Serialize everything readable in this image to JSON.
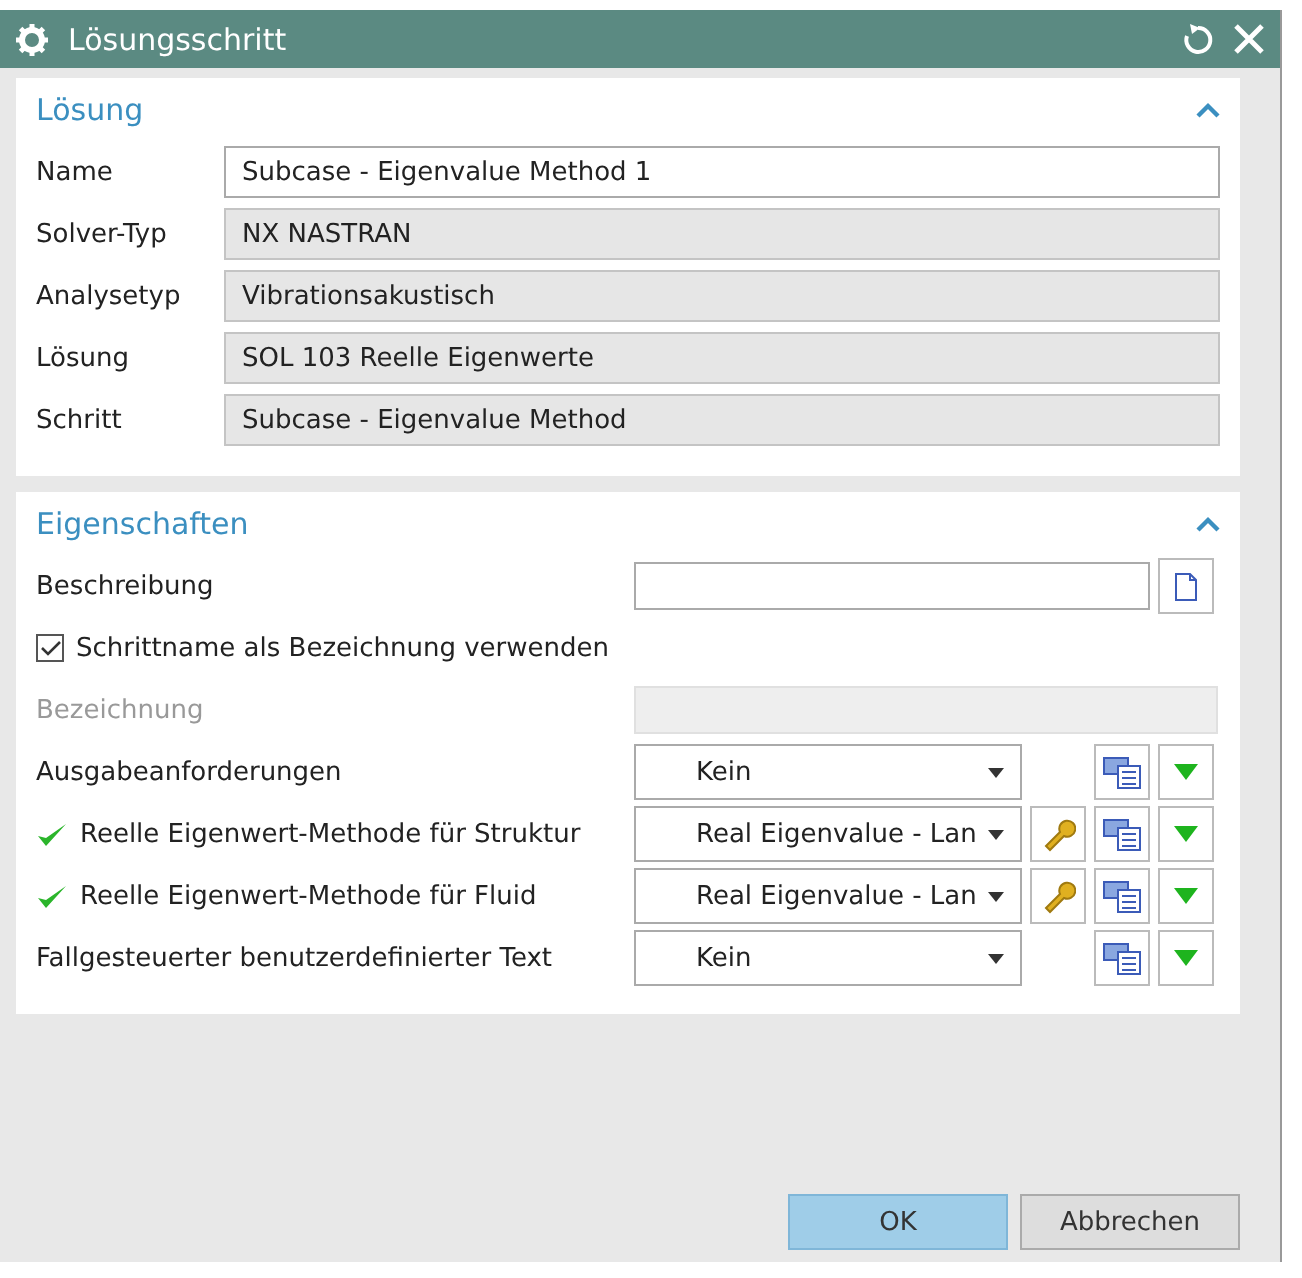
{
  "window": {
    "title": "Lösungsschritt"
  },
  "solution": {
    "title": "Lösung",
    "expanded": true,
    "fields": [
      {
        "label": "Name",
        "value": "Subcase - Eigenvalue Method 1",
        "readonly": false
      },
      {
        "label": "Solver-Typ",
        "value": "NX NASTRAN",
        "readonly": true
      },
      {
        "label": "Analysetyp",
        "value": "Vibrationsakustisch",
        "readonly": true
      },
      {
        "label": "Lösung",
        "value": "SOL 103 Reelle Eigenwerte",
        "readonly": true
      },
      {
        "label": "Schritt",
        "value": "Subcase - Eigenvalue Method",
        "readonly": true
      }
    ]
  },
  "properties": {
    "title": "Eigenschaften",
    "expanded": true,
    "rows": [
      {
        "kind": "text",
        "label": "Beschreibung",
        "disabled": false
      },
      {
        "kind": "checkbox",
        "label": "Schrittname als Bezeichnung verwenden",
        "checked": true
      },
      {
        "kind": "text",
        "label": "Bezeichnung",
        "disabled": true
      },
      {
        "kind": "combo",
        "label": "Ausgabeanforderungen",
        "value": "Kein",
        "valid": false,
        "wrench": false
      },
      {
        "kind": "combo",
        "label": "Reelle Eigenwert-Methode für Struktur",
        "value": "Real Eigenvalue - Lan",
        "valid": true,
        "wrench": true
      },
      {
        "kind": "combo",
        "label": "Reelle Eigenwert-Methode für Fluid",
        "value": "Real Eigenvalue - Lan",
        "valid": true,
        "wrench": true
      },
      {
        "kind": "combo",
        "label": "Fallgesteuerter benutzerdefinierter Text",
        "value": "Kein",
        "valid": false,
        "wrench": false
      }
    ]
  },
  "buttons": [
    {
      "label": "OK",
      "default": true
    },
    {
      "label": "Abbrechen",
      "default": false
    }
  ]
}
